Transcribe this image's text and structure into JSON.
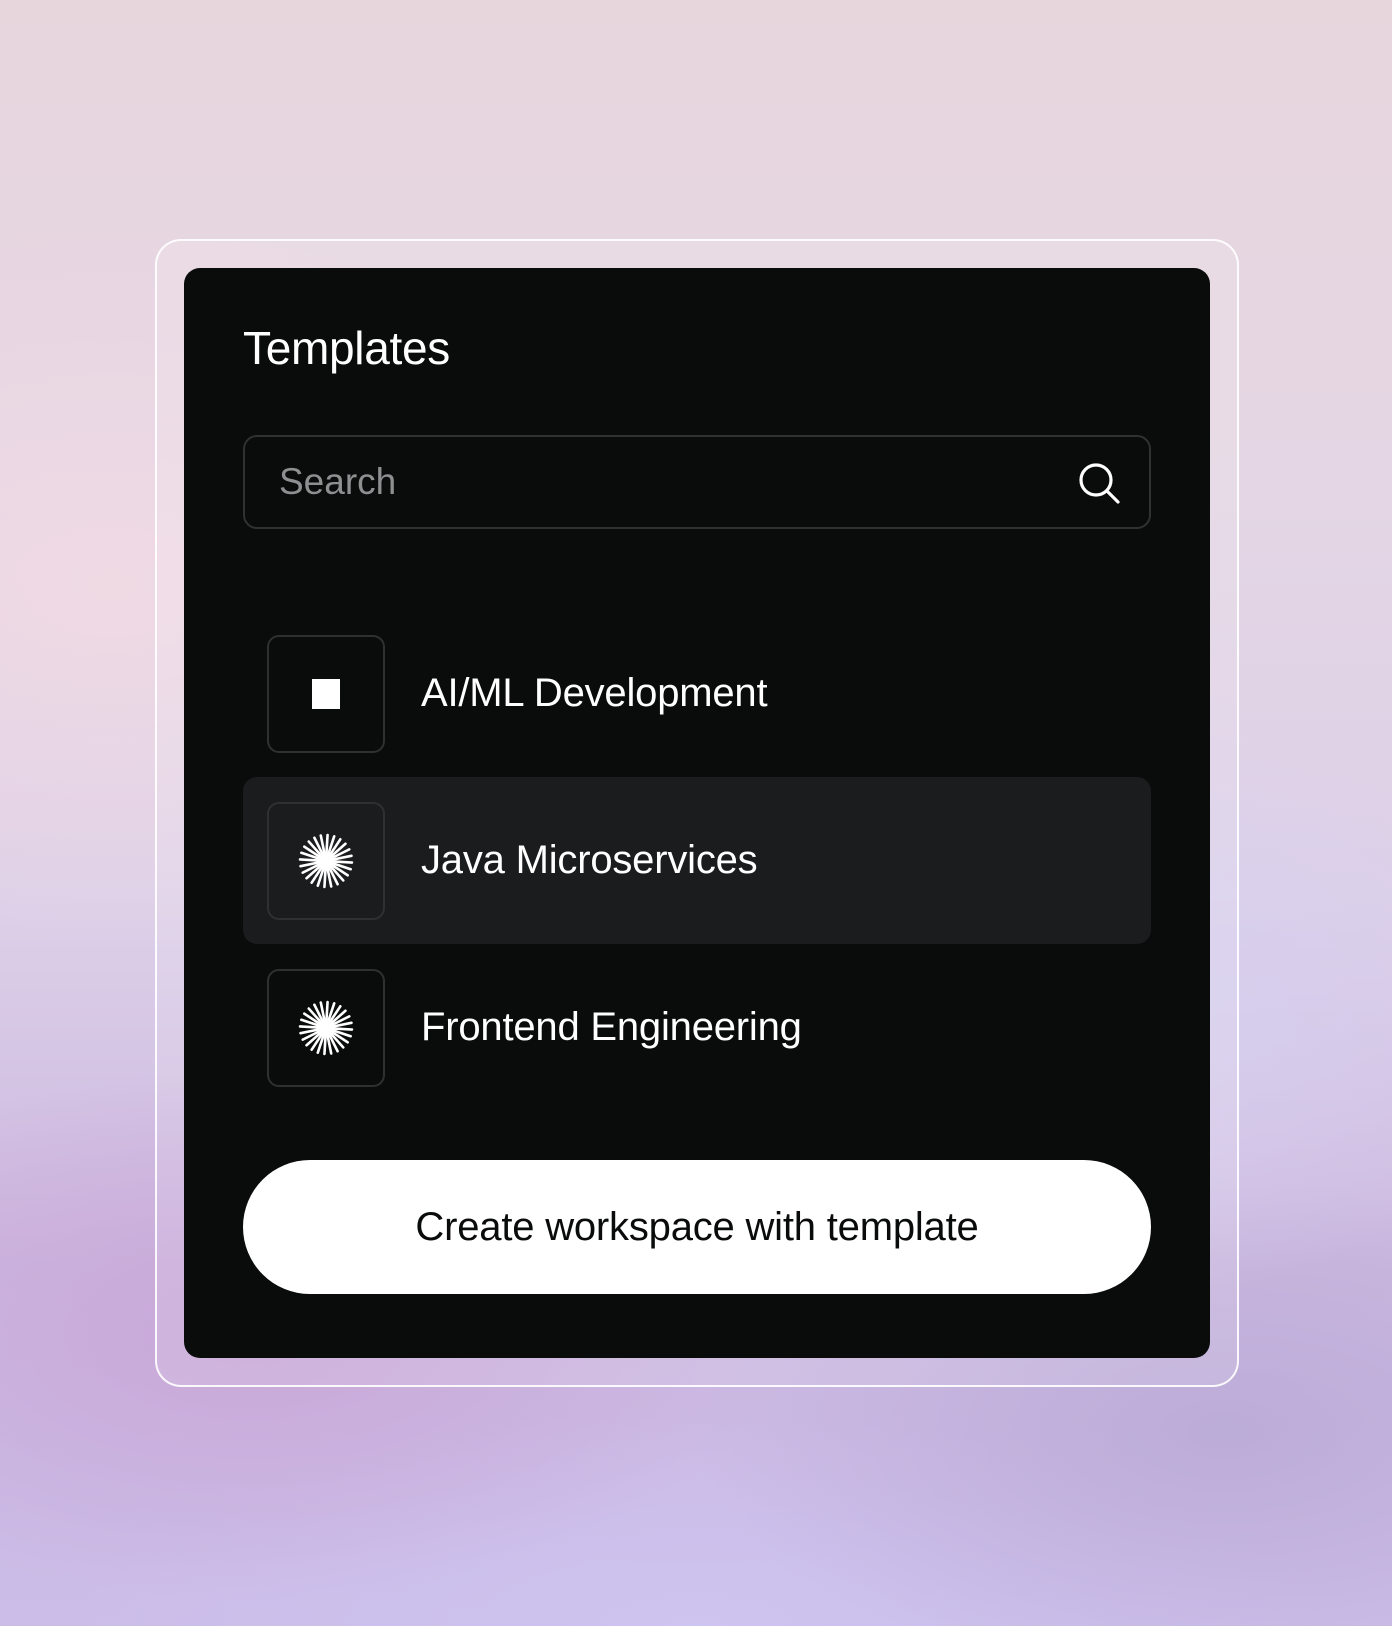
{
  "panel": {
    "title": "Templates"
  },
  "search": {
    "placeholder": "Search",
    "value": "",
    "icon": "search-icon"
  },
  "templates": [
    {
      "label": "AI/ML Development",
      "icon": "square-icon",
      "selected": false
    },
    {
      "label": "Java Microservices",
      "icon": "starburst-icon",
      "selected": true
    },
    {
      "label": "Frontend Engineering",
      "icon": "starburst-icon",
      "selected": false
    }
  ],
  "actions": {
    "create_label": "Create workspace with template"
  },
  "colors": {
    "panel_background": "#0a0b0b",
    "selected_row": "#1b1c1e",
    "border": "#2f3132",
    "placeholder_text": "#8e8f91",
    "button_background": "#ffffff"
  }
}
